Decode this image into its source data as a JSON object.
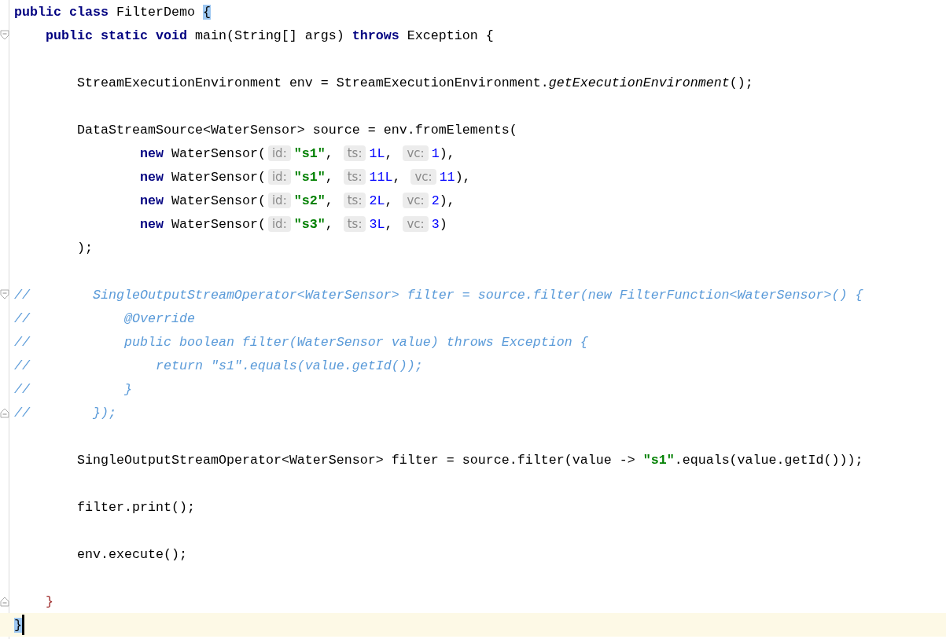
{
  "editor": {
    "lines": [
      {
        "kind": "top",
        "tokens": [
          {
            "kind": "keyword",
            "text": "public class"
          },
          {
            "kind": "plain",
            "text": " FilterDemo "
          },
          {
            "kind": "matched",
            "text": "{"
          }
        ]
      },
      {
        "kind": "member",
        "fold_start": true,
        "tokens": [
          {
            "kind": "keyword",
            "text": "public static void"
          },
          {
            "kind": "plain",
            "text": " main(String[] args) "
          },
          {
            "kind": "keyword",
            "text": "throws"
          },
          {
            "kind": "plain",
            "text": " Exception {"
          }
        ]
      },
      {
        "kind": "blank"
      },
      {
        "kind": "body",
        "tokens": [
          {
            "kind": "plain",
            "text": "StreamExecutionEnvironment env = StreamExecutionEnvironment."
          },
          {
            "kind": "static",
            "text": "getExecutionEnvironment"
          },
          {
            "kind": "plain",
            "text": "();"
          }
        ]
      },
      {
        "kind": "blank"
      },
      {
        "kind": "body",
        "tokens": [
          {
            "kind": "plain",
            "text": "DataStreamSource<WaterSensor> source = env.fromElements("
          }
        ]
      },
      {
        "kind": "args",
        "tokens": [
          {
            "kind": "keyword",
            "text": "new"
          },
          {
            "kind": "plain",
            "text": " WaterSensor("
          },
          {
            "kind": "hint",
            "text": "id:"
          },
          {
            "kind": "string",
            "text": "\"s1\""
          },
          {
            "kind": "plain",
            "text": ", "
          },
          {
            "kind": "hint",
            "text": "ts:"
          },
          {
            "kind": "number",
            "text": "1L"
          },
          {
            "kind": "plain",
            "text": ", "
          },
          {
            "kind": "hint",
            "text": "vc:"
          },
          {
            "kind": "number",
            "text": "1"
          },
          {
            "kind": "plain",
            "text": "),"
          }
        ]
      },
      {
        "kind": "args",
        "tokens": [
          {
            "kind": "keyword",
            "text": "new"
          },
          {
            "kind": "plain",
            "text": " WaterSensor("
          },
          {
            "kind": "hint",
            "text": "id:"
          },
          {
            "kind": "string",
            "text": "\"s1\""
          },
          {
            "kind": "plain",
            "text": ", "
          },
          {
            "kind": "hint",
            "text": "ts:"
          },
          {
            "kind": "number",
            "text": "11L"
          },
          {
            "kind": "plain",
            "text": ", "
          },
          {
            "kind": "hint",
            "text": "vc:"
          },
          {
            "kind": "number",
            "text": "11"
          },
          {
            "kind": "plain",
            "text": "),"
          }
        ]
      },
      {
        "kind": "args",
        "tokens": [
          {
            "kind": "keyword",
            "text": "new"
          },
          {
            "kind": "plain",
            "text": " WaterSensor("
          },
          {
            "kind": "hint",
            "text": "id:"
          },
          {
            "kind": "string",
            "text": "\"s2\""
          },
          {
            "kind": "plain",
            "text": ", "
          },
          {
            "kind": "hint",
            "text": "ts:"
          },
          {
            "kind": "number",
            "text": "2L"
          },
          {
            "kind": "plain",
            "text": ", "
          },
          {
            "kind": "hint",
            "text": "vc:"
          },
          {
            "kind": "number",
            "text": "2"
          },
          {
            "kind": "plain",
            "text": "),"
          }
        ]
      },
      {
        "kind": "args",
        "tokens": [
          {
            "kind": "keyword",
            "text": "new"
          },
          {
            "kind": "plain",
            "text": " WaterSensor("
          },
          {
            "kind": "hint",
            "text": "id:"
          },
          {
            "kind": "string",
            "text": "\"s3\""
          },
          {
            "kind": "plain",
            "text": ", "
          },
          {
            "kind": "hint",
            "text": "ts:"
          },
          {
            "kind": "number",
            "text": "3L"
          },
          {
            "kind": "plain",
            "text": ", "
          },
          {
            "kind": "hint",
            "text": "vc:"
          },
          {
            "kind": "number",
            "text": "3"
          },
          {
            "kind": "plain",
            "text": ")"
          }
        ]
      },
      {
        "kind": "body",
        "tokens": [
          {
            "kind": "plain",
            "text": ");"
          }
        ]
      },
      {
        "kind": "blank"
      },
      {
        "kind": "top",
        "fold_start": true,
        "tokens": [
          {
            "kind": "comment",
            "text": "//        SingleOutputStreamOperator<WaterSensor> filter = source.filter(new FilterFunction<WaterSensor>() {"
          }
        ]
      },
      {
        "kind": "top",
        "tokens": [
          {
            "kind": "comment",
            "text": "//            @Override"
          }
        ]
      },
      {
        "kind": "top",
        "tokens": [
          {
            "kind": "comment",
            "text": "//            public boolean filter(WaterSensor value) throws Exception {"
          }
        ]
      },
      {
        "kind": "top",
        "tokens": [
          {
            "kind": "comment",
            "text": "//                return \"s1\".equals(value.getId());"
          }
        ]
      },
      {
        "kind": "top",
        "tokens": [
          {
            "kind": "comment",
            "text": "//            }"
          }
        ]
      },
      {
        "kind": "top",
        "fold_end": true,
        "tokens": [
          {
            "kind": "comment",
            "text": "//        });"
          }
        ]
      },
      {
        "kind": "blank"
      },
      {
        "kind": "body",
        "tokens": [
          {
            "kind": "plain",
            "text": "SingleOutputStreamOperator<WaterSensor> filter = source.filter(value -> "
          },
          {
            "kind": "string",
            "text": "\"s1\""
          },
          {
            "kind": "plain",
            "text": ".equals(value.getId()));"
          }
        ]
      },
      {
        "kind": "blank"
      },
      {
        "kind": "body",
        "tokens": [
          {
            "kind": "plain",
            "text": "filter.print();"
          }
        ]
      },
      {
        "kind": "blank"
      },
      {
        "kind": "body",
        "tokens": [
          {
            "kind": "plain",
            "text": "env.execute();"
          }
        ]
      },
      {
        "kind": "blank"
      },
      {
        "kind": "member",
        "fold_end": true,
        "tokens": [
          {
            "kind": "unmatched",
            "text": "}"
          }
        ]
      },
      {
        "kind": "top",
        "current": true,
        "caret": true,
        "tokens": [
          {
            "kind": "matched",
            "text": "}"
          }
        ]
      }
    ]
  }
}
